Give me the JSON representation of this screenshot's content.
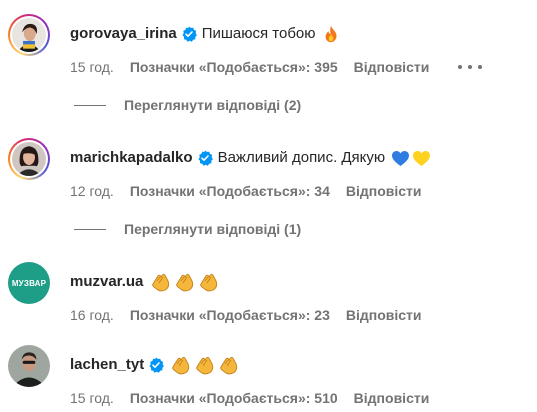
{
  "comments": [
    {
      "username": "gorovaya_irina",
      "verified": true,
      "text": "Пишаюся тобою",
      "emojis": [
        "fire-emoji"
      ],
      "time": "15 год.",
      "likes": "Позначки «Подобається»: 395",
      "reply": "Відповісти",
      "view_replies": "Переглянути відповіді (2)"
    },
    {
      "username": "marichkapadalko",
      "verified": true,
      "text": "Важливий допис. Дякую",
      "emojis": [
        "blue-heart-emoji",
        "yellow-heart-emoji"
      ],
      "time": "12 год.",
      "likes": "Позначки «Подобається»: 34",
      "reply": "Відповісти",
      "view_replies": "Переглянути відповіді (1)"
    },
    {
      "username": "muzvar.ua",
      "verified": false,
      "avatar_text": "МУЗВАР",
      "emojis": [
        "clapping-hands-emoji",
        "clapping-hands-emoji",
        "clapping-hands-emoji"
      ],
      "time": "16 год.",
      "likes": "Позначки «Подобається»: 23",
      "reply": "Відповісти"
    },
    {
      "username": "lachen_tyt",
      "verified": true,
      "emojis": [
        "clapping-hands-emoji",
        "clapping-hands-emoji",
        "clapping-hands-emoji"
      ],
      "time": "15 год.",
      "likes": "Позначки «Подобається»: 510",
      "reply": "Відповісти"
    }
  ],
  "colors": {
    "text": "#262626",
    "secondary": "#737373",
    "verified_blue": "#0095f6",
    "muzvar_green": "#1f9e87"
  },
  "icons": {
    "verified": "verified-badge-icon",
    "more": "more-options-icon"
  }
}
